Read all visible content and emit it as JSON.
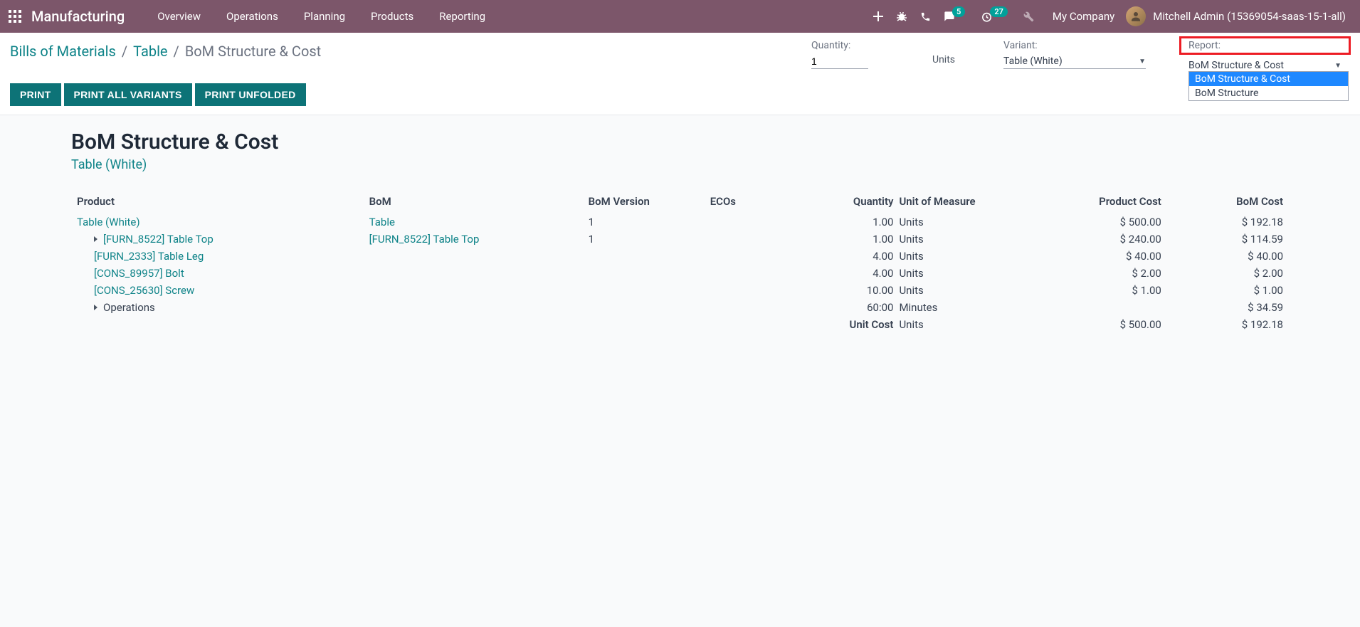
{
  "topnav": {
    "brand": "Manufacturing",
    "menu": [
      "Overview",
      "Operations",
      "Planning",
      "Products",
      "Reporting"
    ],
    "messaging_badge": "5",
    "activity_badge": "27",
    "company": "My Company",
    "user": "Mitchell Admin (15369054-saas-15-1-all)"
  },
  "breadcrumb": {
    "a": "Bills of Materials",
    "b": "Table",
    "c": "BoM Structure & Cost"
  },
  "controls": {
    "qty_label": "Quantity:",
    "qty_value": "1",
    "qty_uom": "Units",
    "variant_label": "Variant:",
    "variant_value": "Table (White)",
    "report_label": "Report:",
    "report_value": "BoM Structure & Cost",
    "report_options": [
      "BoM Structure & Cost",
      "BoM Structure"
    ]
  },
  "actions": {
    "print": "PRINT",
    "print_all": "PRINT ALL VARIANTS",
    "print_unfolded": "PRINT UNFOLDED"
  },
  "report": {
    "title": "BoM Structure & Cost",
    "subtitle": "Table (White)",
    "headers": {
      "product": "Product",
      "bom": "BoM",
      "bom_version": "BoM Version",
      "ecos": "ECOs",
      "quantity": "Quantity",
      "uom": "Unit of Measure",
      "product_cost": "Product Cost",
      "bom_cost": "BoM Cost"
    },
    "rows": [
      {
        "product": "Table (White)",
        "indent": 0,
        "link": true,
        "caret": false,
        "bom": "Table",
        "bom_link": true,
        "version": "1",
        "qty": "1.00",
        "uom": "Units",
        "pcost": "$ 500.00",
        "bcost": "$ 192.18"
      },
      {
        "product": "[FURN_8522] Table Top",
        "indent": 1,
        "link": true,
        "caret": true,
        "bom": "[FURN_8522] Table Top",
        "bom_link": true,
        "version": "1",
        "qty": "1.00",
        "uom": "Units",
        "pcost": "$ 240.00",
        "bcost": "$ 114.59"
      },
      {
        "product": "[FURN_2333] Table Leg",
        "indent": 1,
        "link": true,
        "caret": false,
        "bom": "",
        "version": "",
        "qty": "4.00",
        "uom": "Units",
        "pcost": "$ 40.00",
        "bcost": "$ 40.00"
      },
      {
        "product": "[CONS_89957] Bolt",
        "indent": 1,
        "link": true,
        "caret": false,
        "bom": "",
        "version": "",
        "qty": "4.00",
        "uom": "Units",
        "pcost": "$ 2.00",
        "bcost": "$ 2.00"
      },
      {
        "product": "[CONS_25630] Screw",
        "indent": 1,
        "link": true,
        "caret": false,
        "bom": "",
        "version": "",
        "qty": "10.00",
        "uom": "Units",
        "pcost": "$ 1.00",
        "bcost": "$ 1.00"
      },
      {
        "product": "Operations",
        "indent": 1,
        "link": false,
        "caret": true,
        "bom": "",
        "version": "",
        "qty": "60:00",
        "uom": "Minutes",
        "pcost": "",
        "bcost": "$ 34.59"
      }
    ],
    "footer": {
      "label": "Unit Cost",
      "uom": "Units",
      "pcost": "$ 500.00",
      "bcost": "$ 192.18"
    }
  }
}
